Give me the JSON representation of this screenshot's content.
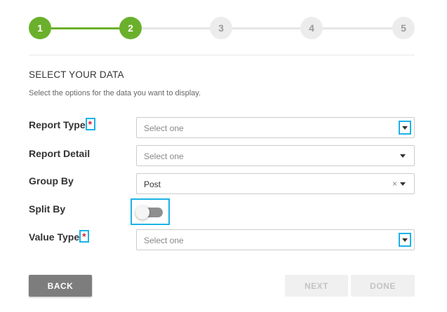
{
  "stepper": {
    "steps": [
      {
        "number": "1",
        "state": "done"
      },
      {
        "number": "2",
        "state": "done"
      },
      {
        "number": "3",
        "state": "todo"
      },
      {
        "number": "4",
        "state": "todo"
      },
      {
        "number": "5",
        "state": "todo"
      }
    ]
  },
  "section": {
    "title": "SELECT YOUR DATA",
    "description": "Select the options for the data you want to display."
  },
  "fields": {
    "report_type": {
      "label": "Report Type",
      "required_mark": "*",
      "placeholder": "Select one"
    },
    "report_detail": {
      "label": "Report Detail",
      "placeholder": "Select one"
    },
    "group_by": {
      "label": "Group By",
      "value": "Post",
      "clear_icon": "×"
    },
    "split_by": {
      "label": "Split By",
      "toggle_on": false
    },
    "value_type": {
      "label": "Value Type",
      "required_mark": "*",
      "placeholder": "Select one"
    }
  },
  "buttons": {
    "back": "BACK",
    "next": "NEXT",
    "done": "DONE"
  },
  "colors": {
    "step_done": "#6ab02c",
    "step_todo": "#ececec",
    "highlight": "#1ab3e6",
    "required": "#d9253b"
  }
}
